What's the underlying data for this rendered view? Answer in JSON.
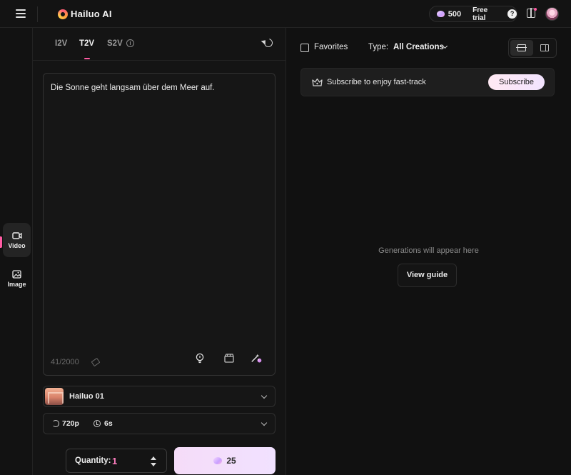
{
  "header": {
    "logo_text": "Hailuo AI",
    "credits": "500",
    "free_trial_label": "Free trial",
    "help_glyph": "?",
    "icons": [
      "menu-icon",
      "credit-gem-icon",
      "help-icon",
      "news-icon",
      "avatar"
    ]
  },
  "sidebar": {
    "items": [
      {
        "label": "Video",
        "icon": "video-icon",
        "active": true
      },
      {
        "label": "Image",
        "icon": "image-icon",
        "active": false
      }
    ]
  },
  "left_panel": {
    "tabs": [
      {
        "label": "I2V",
        "active": false
      },
      {
        "label": "T2V",
        "active": true
      },
      {
        "label": "S2V",
        "active": false
      }
    ],
    "s2v_info_glyph": "i",
    "prompt_text": "Die Sonne geht langsam über dem Meer auf.",
    "char_count": "41/2000",
    "tool_icons": [
      "idea-bulb-icon",
      "clapperboard-icon",
      "magic-enhance-icon"
    ],
    "model": {
      "name": "Hailuo 01"
    },
    "settings": {
      "resolution": "720p",
      "duration": "6s"
    },
    "quantity_label": "Quantity:",
    "quantity_value": "1",
    "generate_cost": "25"
  },
  "right_panel": {
    "favorites_label": "Favorites",
    "type_label": "Type:",
    "type_value": "All Creations",
    "subscribe_banner_text": "Subscribe to enjoy fast-track",
    "subscribe_button": "Subscribe",
    "empty_state_text": "Generations will appear here",
    "view_guide_button": "View guide"
  },
  "colors": {
    "accent_pink": "#ff5ba3",
    "quantity_value": "#ff7fc0",
    "generate_button_bg": "#f3dff9",
    "background": "#101010"
  }
}
